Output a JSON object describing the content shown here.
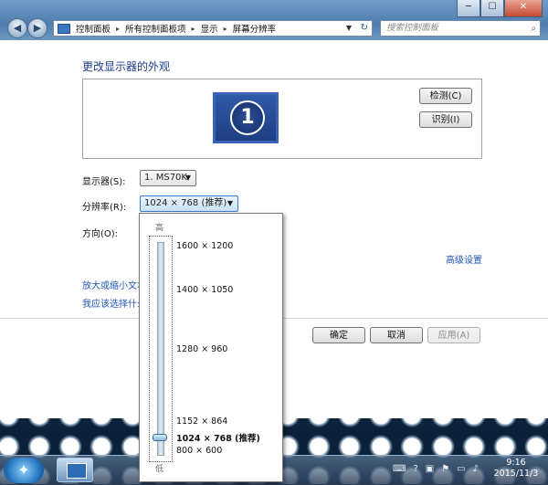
{
  "window": {
    "buttons": {
      "minimize": "─",
      "maximize": "☐",
      "close": "✕"
    },
    "nav": {
      "back": "◀",
      "forward": "▶"
    },
    "breadcrumbs": [
      "控制面板",
      "所有控制面板项",
      "显示",
      "屏幕分辨率"
    ],
    "search_placeholder": "搜索控制面板"
  },
  "page": {
    "heading": "更改显示器的外观",
    "monitor_number": "1",
    "detect_button": "检测(C)",
    "identify_button": "识别(I)",
    "display_label": "显示器(S):",
    "display_value": "1. MS70K",
    "resolution_label": "分辨率(R):",
    "resolution_value": "1024 × 768 (推荐)",
    "orientation_label": "方向(O):",
    "advanced_link": "高级设置",
    "text_size_link": "放大或缩小文本",
    "which_settings_link": "我应该选择什么",
    "ok_button": "确定",
    "cancel_button": "取消",
    "apply_button": "应用(A)"
  },
  "resolution_popup": {
    "high_label": "高",
    "low_label": "低",
    "options": [
      "1600 × 1200",
      "1400 × 1050",
      "1280 × 960",
      "1152 × 864",
      "1024 × 768 (推荐)",
      "800 × 600"
    ],
    "selected_index": 4
  },
  "taskbar": {
    "time": "9:16",
    "date": "2015/11/3"
  }
}
